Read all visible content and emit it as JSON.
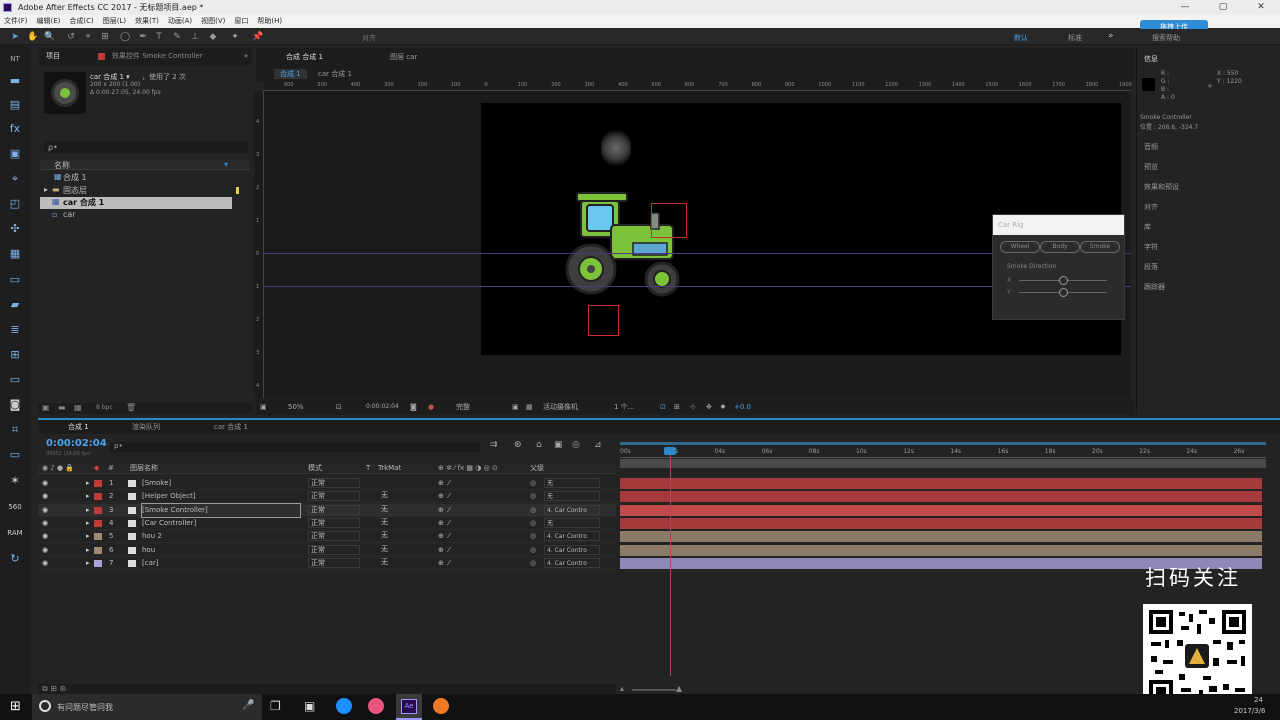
{
  "window": {
    "title": "Adobe After Effects CC 2017 - 无标题项目.aep *"
  },
  "menu": [
    "文件(F)",
    "编辑(E)",
    "合成(C)",
    "图层(L)",
    "效果(T)",
    "动画(A)",
    "视图(V)",
    "窗口",
    "帮助(H)"
  ],
  "upload_button": "拖拽上传",
  "toolbar": {
    "align_label": "对齐",
    "workspace_default": "默认",
    "workspace_standard": "标准",
    "search_help": "搜索帮助"
  },
  "project": {
    "tab_project": "项目",
    "tab_effects": "效果控件 Smoke Controller",
    "selected_name": "car 合成 1 ▾",
    "used_count": "，使用了 2 次",
    "dims": "200 x 200 (1.00)",
    "duration": "Δ 0:00:27:05, 24.00 fps",
    "search_placeholder": "ρ•",
    "column_name": "名称",
    "items": [
      "合成 1",
      "固态层",
      "car 合成 1",
      "car"
    ],
    "bpc": "8 bpc"
  },
  "viewer": {
    "tab_comp": "合成 合成 1",
    "tab_layer": "图层 car",
    "crumb_1": "合成 1",
    "crumb_2": "car 合成 1",
    "zoom": "50%",
    "timecode": "0:00:02:04",
    "resolution": "完整",
    "camera": "活动摄像机",
    "views": "1 个...",
    "exposure": "+0.0",
    "ruler_h": [
      "600",
      "500",
      "400",
      "300",
      "200",
      "100",
      "0",
      "100",
      "200",
      "300",
      "400",
      "500",
      "600",
      "700",
      "800",
      "900",
      "1000",
      "1100",
      "1200",
      "1300",
      "1400",
      "1500",
      "1600",
      "1700",
      "1800",
      "1900"
    ],
    "ruler_v": [
      "4",
      "3",
      "2",
      "1",
      "0",
      "1",
      "2",
      "3",
      "4"
    ]
  },
  "info": {
    "title": "信息",
    "r": "R :",
    "g": "G :",
    "b": "B :",
    "a": "A : 0",
    "x": "X : 550",
    "y": "Y : 1220",
    "layer_name": "Smoke Controller",
    "position": "位置 : 208.6, -324.7",
    "panels": [
      "音频",
      "预览",
      "效果和预设",
      "对齐",
      "库",
      "字符",
      "段落",
      "跟踪器"
    ]
  },
  "car_rig": {
    "title": "Car Rig",
    "buttons": [
      "Wheel",
      "Body",
      "Smoke"
    ],
    "section": "Smoke Direction",
    "x": "X",
    "y": "Y"
  },
  "timeline": {
    "tab_comp": "合成 1",
    "tab_render": "渲染队列",
    "tab_car": "car 合成 1",
    "timecode": "0:00:02:04",
    "frames": "00052 (24.00 fps)",
    "search_placeholder": "ρ•",
    "col_layer_name": "图层名称",
    "col_mode": "模式",
    "col_t": "T",
    "col_trkmat": "TrkMat",
    "col_parent": "父级",
    "ticks": [
      "00s",
      "02s",
      "04s",
      "06s",
      "08s",
      "10s",
      "12s",
      "14s",
      "16s",
      "18s",
      "20s",
      "22s",
      "24s",
      "26s"
    ],
    "layers": [
      {
        "num": "1",
        "name": "[Smoke]",
        "mode": "正常",
        "trk": "",
        "parent": "无",
        "color": "#c03a3a",
        "bar": "#a5393b"
      },
      {
        "num": "2",
        "name": "[Helper Object]",
        "mode": "正常",
        "trk": "无",
        "parent": "无",
        "color": "#c03a3a",
        "bar": "#a5393b"
      },
      {
        "num": "3",
        "name": "[Smoke Controller]",
        "mode": "正常",
        "trk": "无",
        "parent": "4. Car Contro",
        "color": "#c03a3a",
        "bar": "#c34a4b"
      },
      {
        "num": "4",
        "name": "[Car Controller]",
        "mode": "正常",
        "trk": "无",
        "parent": "无",
        "color": "#c03a3a",
        "bar": "#a5393b"
      },
      {
        "num": "5",
        "name": "hou 2",
        "mode": "正常",
        "trk": "无",
        "parent": "4. Car Contro",
        "color": "#9e8a72",
        "bar": "#8a7a66"
      },
      {
        "num": "6",
        "name": "hou",
        "mode": "正常",
        "trk": "无",
        "parent": "4. Car Contro",
        "color": "#9e8a72",
        "bar": "#8a7a66"
      },
      {
        "num": "7",
        "name": "[car]",
        "mode": "正常",
        "trk": "无",
        "parent": "4. Car Contro",
        "color": "#a9a3d6",
        "bar": "#8d88b5"
      }
    ]
  },
  "overlay": {
    "scan_text": "扫码关注"
  },
  "taskbar": {
    "search_placeholder": "有问题尽管问我",
    "time": "24",
    "date": "2017/3/6"
  },
  "colors": {
    "accent": "#2d89c8",
    "tractor": "#7cc23a",
    "label_red": "#c03a3a"
  }
}
